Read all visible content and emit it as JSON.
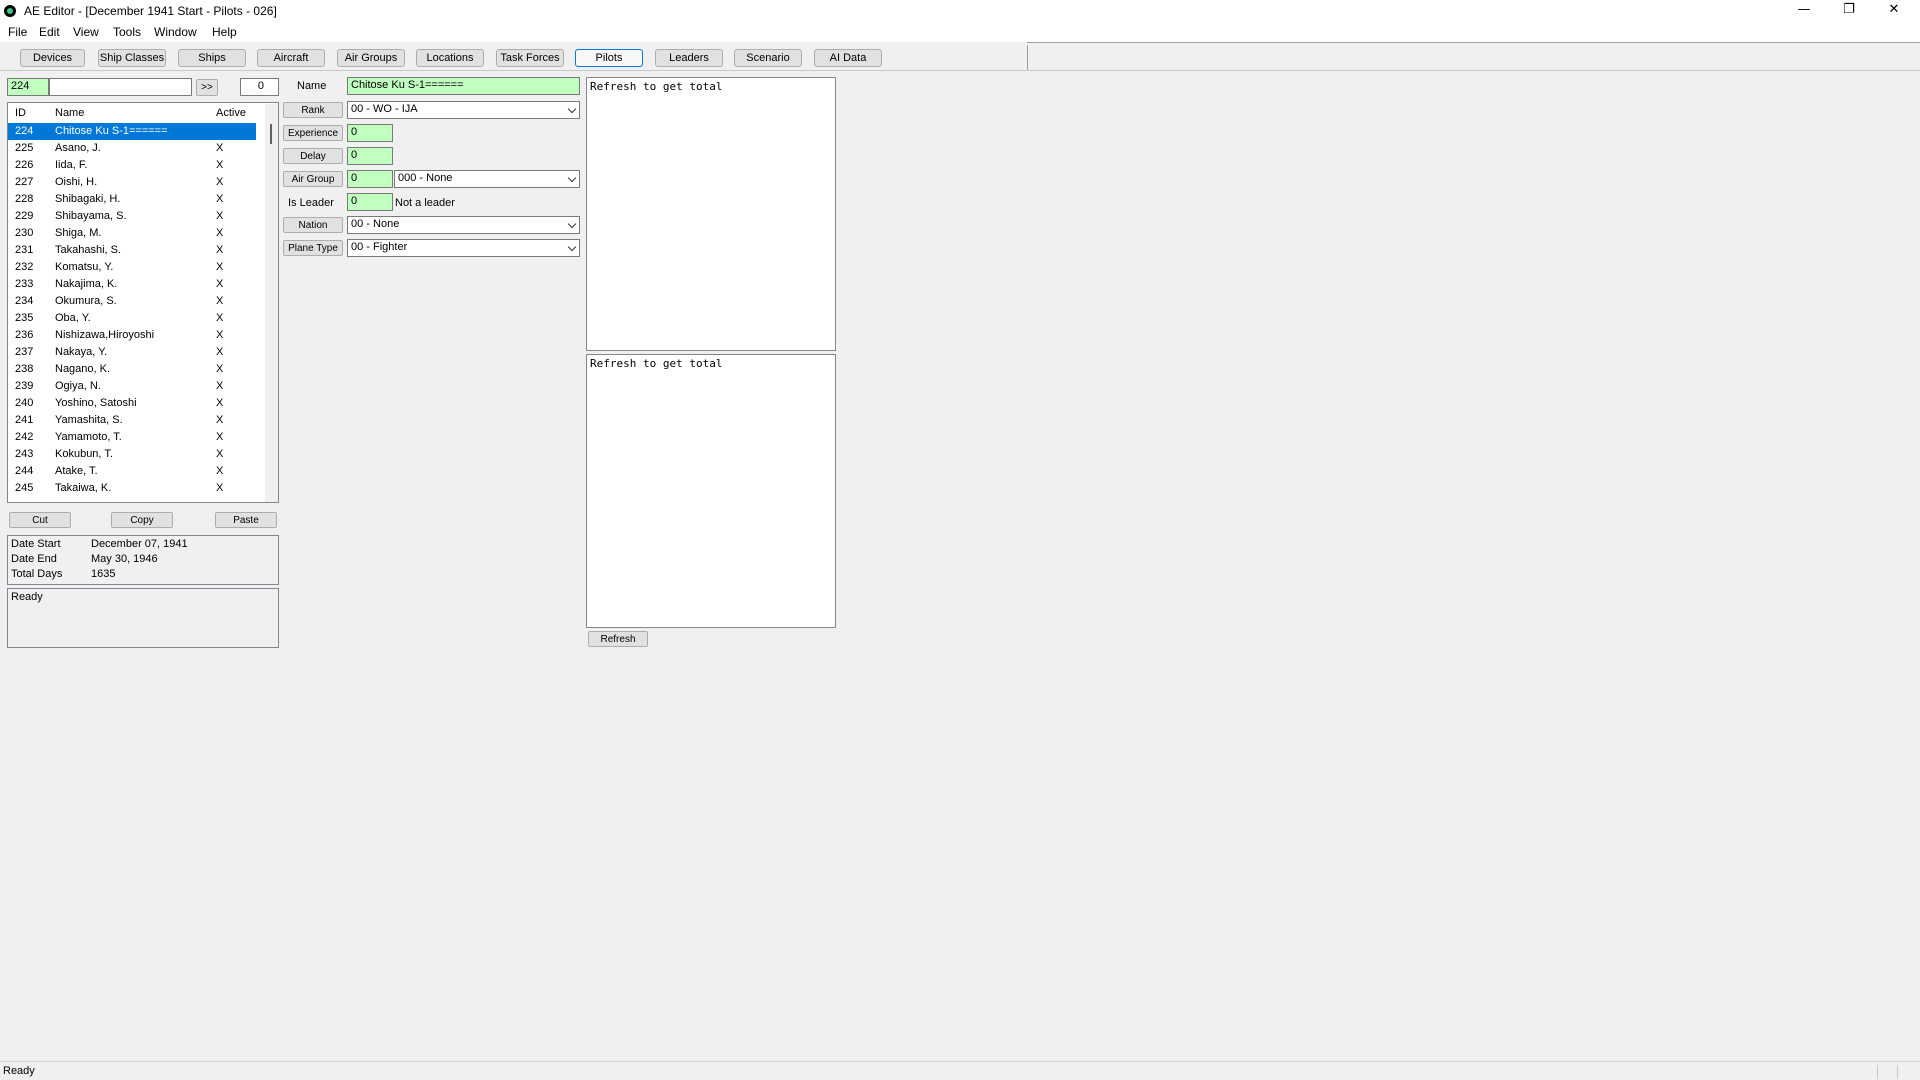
{
  "window": {
    "title": "AE Editor - [December 1941 Start - Pilots - 026]",
    "minimize_glyph": "—",
    "maximize_glyph": "❐",
    "close_glyph": "✕"
  },
  "menu": [
    "File",
    "Edit",
    "View",
    "Tools",
    "Window",
    "Help"
  ],
  "toolbar": {
    "tabs": [
      "Devices",
      "Ship Classes",
      "Ships",
      "Aircraft",
      "Air Groups",
      "Locations",
      "Task Forces",
      "Pilots",
      "Leaders",
      "Scenario",
      "AI Data"
    ],
    "active_tab": "Pilots"
  },
  "search": {
    "id_value": "224",
    "text_value": "",
    "go_label": ">>",
    "count_value": "0"
  },
  "list": {
    "columns": [
      "ID",
      "Name",
      "Active"
    ],
    "rows": [
      {
        "id": "224",
        "name": "Chitose Ku S-1======",
        "active": ""
      },
      {
        "id": "225",
        "name": "Asano, J.",
        "active": "X"
      },
      {
        "id": "226",
        "name": "Iida, F.",
        "active": "X"
      },
      {
        "id": "227",
        "name": "Oishi, H.",
        "active": "X"
      },
      {
        "id": "228",
        "name": "Shibagaki, H.",
        "active": "X"
      },
      {
        "id": "229",
        "name": "Shibayama, S.",
        "active": "X"
      },
      {
        "id": "230",
        "name": "Shiga, M.",
        "active": "X"
      },
      {
        "id": "231",
        "name": "Takahashi, S.",
        "active": "X"
      },
      {
        "id": "232",
        "name": "Komatsu, Y.",
        "active": "X"
      },
      {
        "id": "233",
        "name": "Nakajima, K.",
        "active": "X"
      },
      {
        "id": "234",
        "name": "Okumura, S.",
        "active": "X"
      },
      {
        "id": "235",
        "name": "Oba, Y.",
        "active": "X"
      },
      {
        "id": "236",
        "name": "Nishizawa,Hiroyoshi",
        "active": "X"
      },
      {
        "id": "237",
        "name": "Nakaya, Y.",
        "active": "X"
      },
      {
        "id": "238",
        "name": "Nagano, K.",
        "active": "X"
      },
      {
        "id": "239",
        "name": "Ogiya, N.",
        "active": "X"
      },
      {
        "id": "240",
        "name": "Yoshino, Satoshi",
        "active": "X"
      },
      {
        "id": "241",
        "name": "Yamashita, S.",
        "active": "X"
      },
      {
        "id": "242",
        "name": "Yamamoto, T.",
        "active": "X"
      },
      {
        "id": "243",
        "name": "Kokubun, T.",
        "active": "X"
      },
      {
        "id": "244",
        "name": "Atake, T.",
        "active": "X"
      },
      {
        "id": "245",
        "name": "Takaiwa, K.",
        "active": "X"
      }
    ]
  },
  "clipboard": {
    "cut": "Cut",
    "copy": "Copy",
    "paste": "Paste"
  },
  "dates": {
    "start_label": "Date Start",
    "start_value": "December 07, 1941",
    "end_label": "Date End",
    "end_value": "May 30, 1946",
    "days_label": "Total Days",
    "days_value": "1635"
  },
  "panel_status": "Ready",
  "form": {
    "name_label": "Name",
    "name_value": "Chitose Ku S-1======",
    "rank_label": "Rank",
    "rank_value": "00 - WO - IJA",
    "experience_label": "Experience",
    "experience_value": "0",
    "delay_label": "Delay",
    "delay_value": "0",
    "air_group_label": "Air Group",
    "air_group_value": "0",
    "air_group_select": "000 - None",
    "leader_label": "Is Leader",
    "leader_value": "0",
    "leader_text": "Not a leader",
    "nation_label": "Nation",
    "nation_value": "00 - None",
    "plane_type_label": "Plane Type",
    "plane_type_value": "00 - Fighter"
  },
  "totals": {
    "box1": "Refresh to get total",
    "box2": "Refresh to get total",
    "refresh_label": "Refresh"
  },
  "statusbar": {
    "text": "Ready"
  }
}
